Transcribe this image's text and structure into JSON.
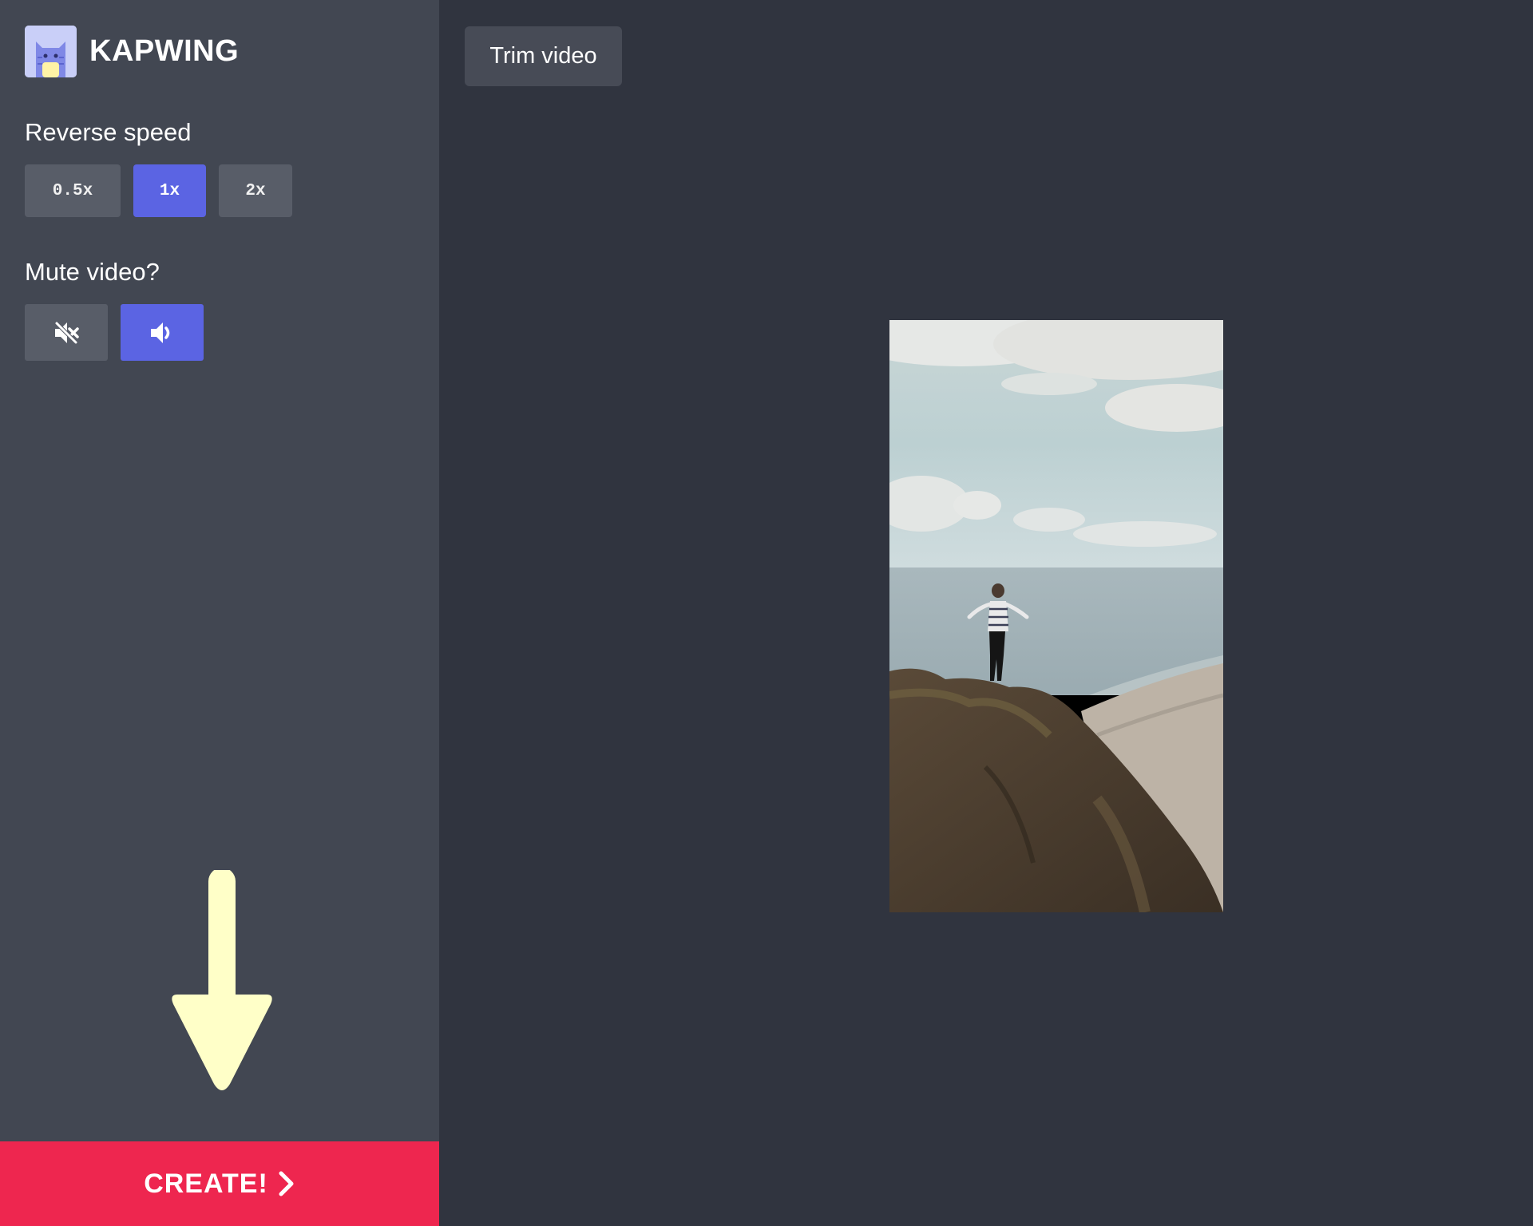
{
  "app": {
    "name": "KAPWING",
    "logo_icon": "kapwing-cat-logo-icon"
  },
  "sidebar": {
    "reverse_speed": {
      "label": "Reverse speed",
      "options": [
        "0.5x",
        "1x",
        "2x"
      ],
      "selected": "1x"
    },
    "mute": {
      "label": "Mute video?",
      "options": [
        {
          "icon": "speaker-muted-icon",
          "selected": false
        },
        {
          "icon": "speaker-on-icon",
          "selected": true
        }
      ]
    },
    "create_button": {
      "label": "CREATE!",
      "icon": "chevron-right-icon"
    },
    "hint_arrow_icon": "arrow-down-icon"
  },
  "main": {
    "trim_button_label": "Trim video",
    "preview": {
      "description_icon": "video-preview"
    }
  },
  "colors": {
    "sidebar_bg": "#424752",
    "main_bg": "#30343f",
    "accent": "#5b64e3",
    "create": "#ee264f",
    "hint_arrow": "#ffffc8"
  }
}
